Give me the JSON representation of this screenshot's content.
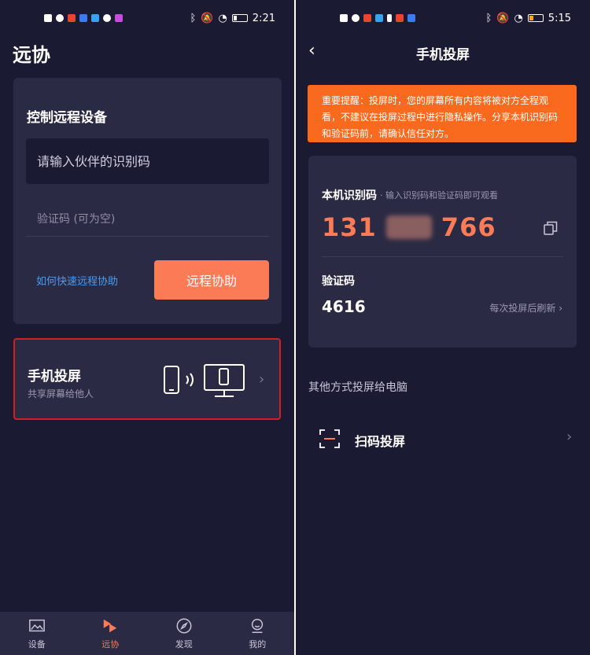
{
  "left_screen": {
    "status": {
      "time": "2:21"
    },
    "app_title": "远协",
    "remote_card": {
      "title": "控制远程设备",
      "partner_id_placeholder": "请输入伙伴的识别码",
      "verify_code_placeholder": "验证码 (可为空)",
      "help_link": "如何快速远程协助",
      "assist_button": "远程协助"
    },
    "cast_card": {
      "title": "手机投屏",
      "subtitle": "共享屏幕给他人"
    },
    "tabs": [
      {
        "label": "设备",
        "icon": "image-icon",
        "active": false
      },
      {
        "label": "远协",
        "icon": "remote-assist-icon",
        "active": true
      },
      {
        "label": "发现",
        "icon": "compass-icon",
        "active": false
      },
      {
        "label": "我的",
        "icon": "user-icon",
        "active": false
      }
    ]
  },
  "right_screen": {
    "status": {
      "time": "5:15"
    },
    "page_title": "手机投屏",
    "notice": "重要提醒：投屏时，您的屏幕所有内容将被对方全程观看，不建议在投屏过程中进行隐私操作。分享本机识别码和验证码前，请确认信任对方。",
    "device_id": {
      "label": "本机识别码",
      "hint": "· 输入识别码和验证码即可观看",
      "prefix": "131",
      "suffix": "766"
    },
    "verify_code": {
      "label": "验证码",
      "value": "4616",
      "refresh_hint": "每次投屏后刷新"
    },
    "other_methods_title": "其他方式投屏给电脑",
    "scan_cast_label": "扫码投屏"
  },
  "colors": {
    "background": "#1b1a33",
    "card": "#2b2a44",
    "accent": "#fa7b55",
    "notice": "#fa6a1e",
    "link": "#4a9cf0",
    "highlight_border": "#d21f1f"
  }
}
